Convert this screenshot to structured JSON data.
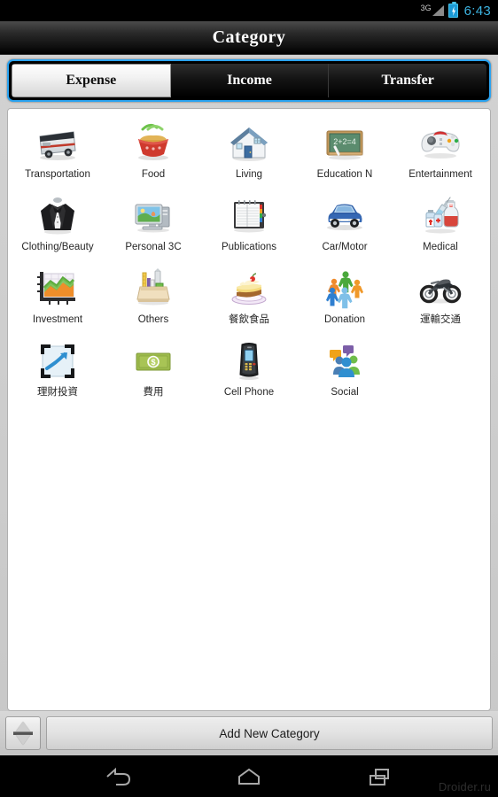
{
  "statusbar": {
    "network_label": "3G",
    "signal_icon": "signal-triangle-icon",
    "battery_icon": "battery-charging-icon",
    "time": "6:43",
    "accent_color": "#3cb3e0"
  },
  "titlebar": {
    "title": "Category"
  },
  "tabs": {
    "border_color": "#2aa3f0",
    "selected_index": 0,
    "items": [
      {
        "label": "Expense"
      },
      {
        "label": "Income"
      },
      {
        "label": "Transfer"
      }
    ]
  },
  "grid": {
    "columns": 5,
    "items": [
      {
        "label": "Transportation",
        "icon": "bus-icon"
      },
      {
        "label": "Food",
        "icon": "noodle-bowl-icon"
      },
      {
        "label": "Living",
        "icon": "house-icon"
      },
      {
        "label": "Education N",
        "icon": "blackboard-icon",
        "icon_text": "2+2=4"
      },
      {
        "label": "Entertainment",
        "icon": "gamepad-icon"
      },
      {
        "label": "Clothing/Beauty",
        "icon": "tuxedo-icon"
      },
      {
        "label": "Personal 3C",
        "icon": "computer-monitor-icon"
      },
      {
        "label": "Publications",
        "icon": "notebook-icon"
      },
      {
        "label": "Car/Motor",
        "icon": "car-icon"
      },
      {
        "label": "Medical",
        "icon": "syringe-medicine-icon"
      },
      {
        "label": "Investment",
        "icon": "bar-chart-icon"
      },
      {
        "label": "Others",
        "icon": "supply-box-icon"
      },
      {
        "label": "餐飲食品",
        "icon": "cake-slice-icon"
      },
      {
        "label": "Donation",
        "icon": "people-circle-icon"
      },
      {
        "label": "運輸交通",
        "icon": "motorcycle-icon"
      },
      {
        "label": "理財投資",
        "icon": "trend-arrow-icon"
      },
      {
        "label": "費用",
        "icon": "money-bill-icon"
      },
      {
        "label": "Cell Phone",
        "icon": "mobile-phone-icon"
      },
      {
        "label": "Social",
        "icon": "social-people-icon"
      }
    ]
  },
  "bottombar": {
    "sort_button_icon": "sort-updown-icon",
    "add_label": "Add New Category"
  },
  "navbar": {
    "back_icon": "back-arrow-icon",
    "home_icon": "home-icon",
    "recents_icon": "recent-apps-icon"
  },
  "watermark": {
    "text": "Droider.ru"
  }
}
